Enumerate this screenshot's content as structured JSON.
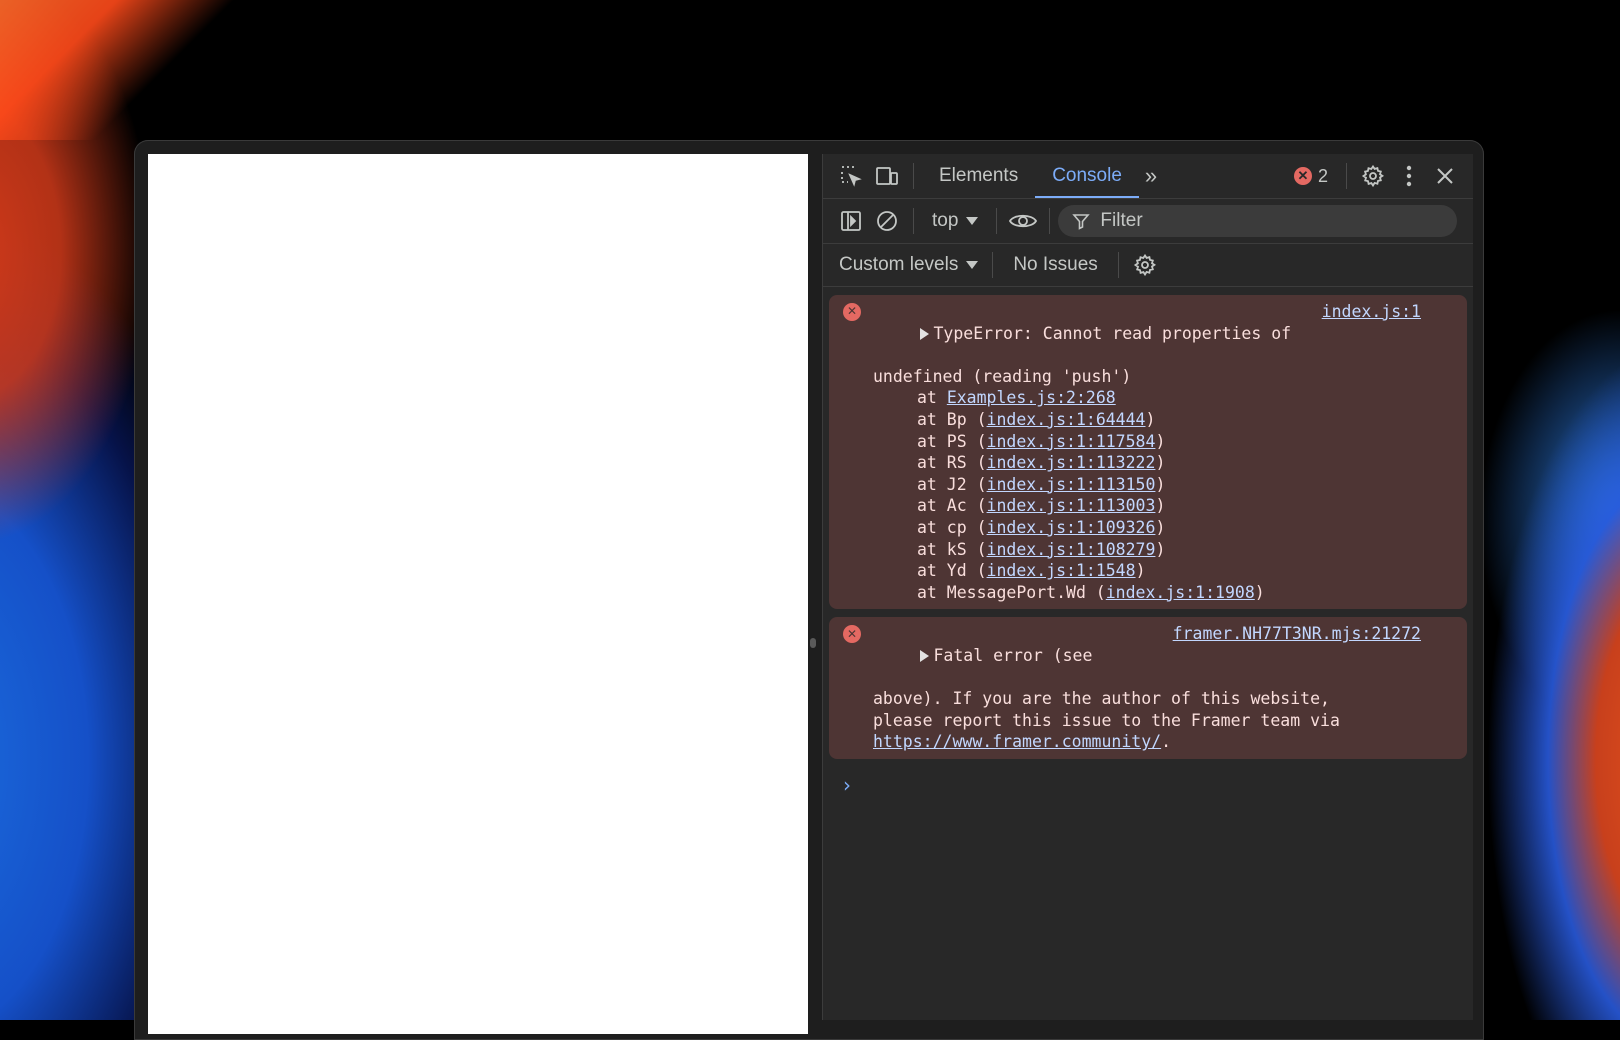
{
  "devtools": {
    "tabs": [
      {
        "label": "Elements"
      },
      {
        "label": "Console"
      }
    ],
    "more_tabs": "»",
    "error_count": "2",
    "error_badge_icon": "error-circle-icon",
    "context": "top",
    "filter_placeholder": "Filter",
    "custom_levels": "Custom levels",
    "no_issues": "No Issues"
  },
  "console": {
    "messages": [
      {
        "source": "index.js:1",
        "text1": "TypeError: Cannot read properties of",
        "text2": "undefined (reading 'push')",
        "stack": [
          {
            "prefix": "at ",
            "link": "Examples.js:2:268",
            "suffix": ""
          },
          {
            "prefix": "at Bp (",
            "link": "index.js:1:64444",
            "suffix": ")"
          },
          {
            "prefix": "at PS (",
            "link": "index.js:1:117584",
            "suffix": ")"
          },
          {
            "prefix": "at RS (",
            "link": "index.js:1:113222",
            "suffix": ")"
          },
          {
            "prefix": "at J2 (",
            "link": "index.js:1:113150",
            "suffix": ")"
          },
          {
            "prefix": "at Ac (",
            "link": "index.js:1:113003",
            "suffix": ")"
          },
          {
            "prefix": "at cp (",
            "link": "index.js:1:109326",
            "suffix": ")"
          },
          {
            "prefix": "at kS (",
            "link": "index.js:1:108279",
            "suffix": ")"
          },
          {
            "prefix": "at Yd (",
            "link": "index.js:1:1548",
            "suffix": ")"
          },
          {
            "prefix": "at MessagePort.Wd (",
            "link": "index.js:1:1908",
            "suffix": ")"
          }
        ]
      },
      {
        "source": "framer.NH77T3NR.mjs:21272",
        "text1": "Fatal error (see",
        "text2": "above). If you are the author of this website,",
        "text3": "please report this issue to the Framer team via",
        "link": "https://www.framer.community/",
        "link_suffix": "."
      }
    ],
    "prompt": "›"
  },
  "colors": {
    "accent": "#7cacf8",
    "error": "#e46962",
    "error_bg": "#4e3534",
    "panel_bg": "#282828"
  }
}
